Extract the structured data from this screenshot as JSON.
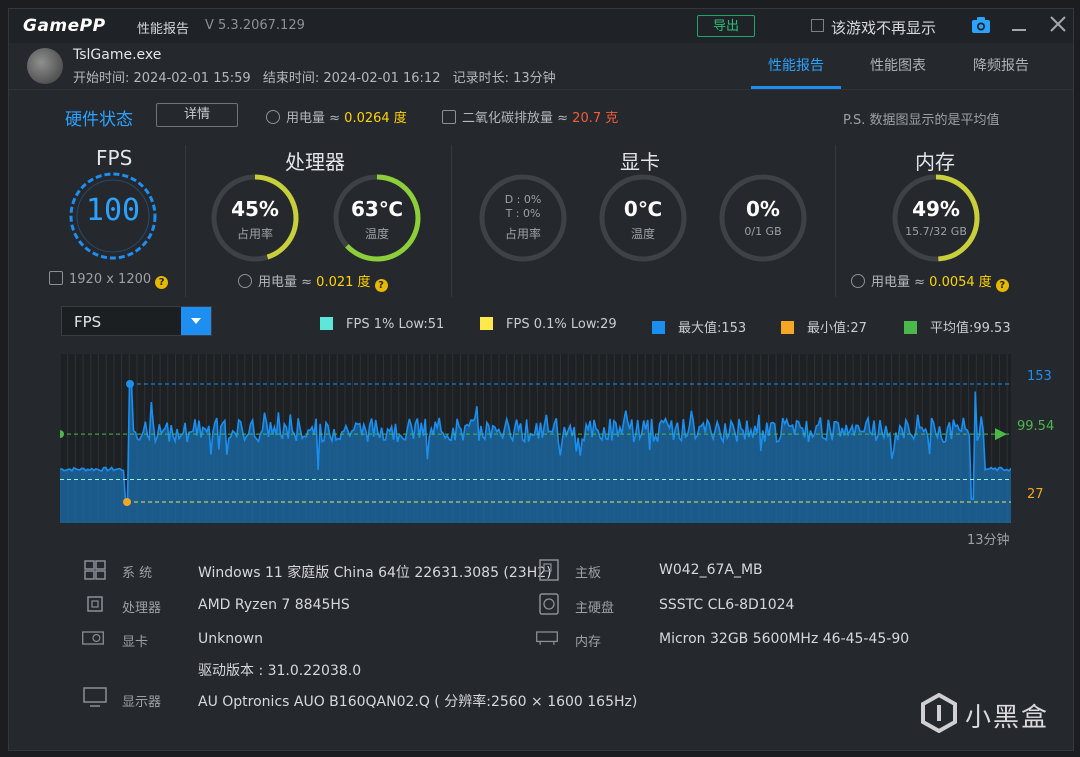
{
  "titlebar": {
    "logo": "GamePP",
    "title": "性能报告",
    "version": "V 5.3.2067.129",
    "export_label": "导出",
    "checkbox_label": "该游戏不再显示"
  },
  "header": {
    "game_name": "TslGame.exe",
    "start_time": "开始时间: 2024-02-01 15:59",
    "end_time": "结束时间: 2024-02-01 16:12",
    "duration": "记录时长: 13分钟",
    "tabs": [
      "性能报告",
      "性能图表",
      "降频报告"
    ]
  },
  "hardware": {
    "title": "硬件状态",
    "detail_label": "详情",
    "power_label": "用电量 ≈",
    "power_value": "0.0264 度",
    "co2_label": "二氧化碳排放量 ≈",
    "co2_value": "20.7 克",
    "ps_note": "P.S. 数据图显示的是平均值"
  },
  "gauges": {
    "fps": {
      "title": "FPS",
      "value": "100",
      "resolution": "1920 x 1200"
    },
    "cpu": {
      "title": "处理器",
      "usage": {
        "value": "45%",
        "label": "占用率",
        "level": 0.45
      },
      "temp": {
        "value": "63℃",
        "label": "温度",
        "level": 0.63
      },
      "power_label": "用电量 ≈",
      "power_value": "0.021 度"
    },
    "gpu": {
      "title": "显卡",
      "usage": {
        "line1": "D : 0%",
        "line2": "T : 0%",
        "label": "占用率"
      },
      "temp": {
        "value": "0℃",
        "label": "温度"
      },
      "mem": {
        "value": "0%",
        "label": "0/1 GB"
      }
    },
    "ram": {
      "title": "内存",
      "usage": {
        "value": "49%",
        "label": "15.7/32 GB",
        "level": 0.49
      },
      "power_label": "用电量 ≈",
      "power_value": "0.0054 度"
    }
  },
  "chart_controls": {
    "select_value": "FPS",
    "legend": [
      {
        "label": "FPS 1% Low:51",
        "color": "#5ee7d8"
      },
      {
        "label": "FPS 0.1% Low:29",
        "color": "#ffe84a"
      },
      {
        "label": "最大值:153",
        "color": "#1a8ff0"
      },
      {
        "label": "最小值:27",
        "color": "#f5a623"
      },
      {
        "label": "平均值:99.53",
        "color": "#4cb84c"
      }
    ]
  },
  "chart_data": {
    "type": "area",
    "max": 153,
    "min": 27,
    "avg": 99.54,
    "low_1pct": 51,
    "low_01pct": 29,
    "max_label": "153",
    "min_label": "27",
    "avg_label": "99.54",
    "x_end_label": "13分钟"
  },
  "system_info": {
    "os_label": "系  统",
    "os_value": "Windows 11 家庭版 China 64位 22631.3085 (23H2)",
    "cpu_label": "处理器",
    "cpu_value": "AMD Ryzen 7 8845HS",
    "gpu_label": "显卡",
    "gpu_value": "Unknown",
    "driver_value": "驱动版本 : 31.0.22038.0",
    "display_label": "显示器",
    "display_value": "AU Optronics AUO B160QAN02.Q ( 分辨率:2560 × 1600 165Hz)",
    "board_label": "主板",
    "board_value": "W042_67A_MB",
    "disk_label": "主硬盘",
    "disk_value": "SSSTC CL6-8D1024",
    "ram_label": "内存",
    "ram_value": "Micron 32GB 5600MHz 46-45-45-90"
  },
  "watermark": "小黑盒"
}
